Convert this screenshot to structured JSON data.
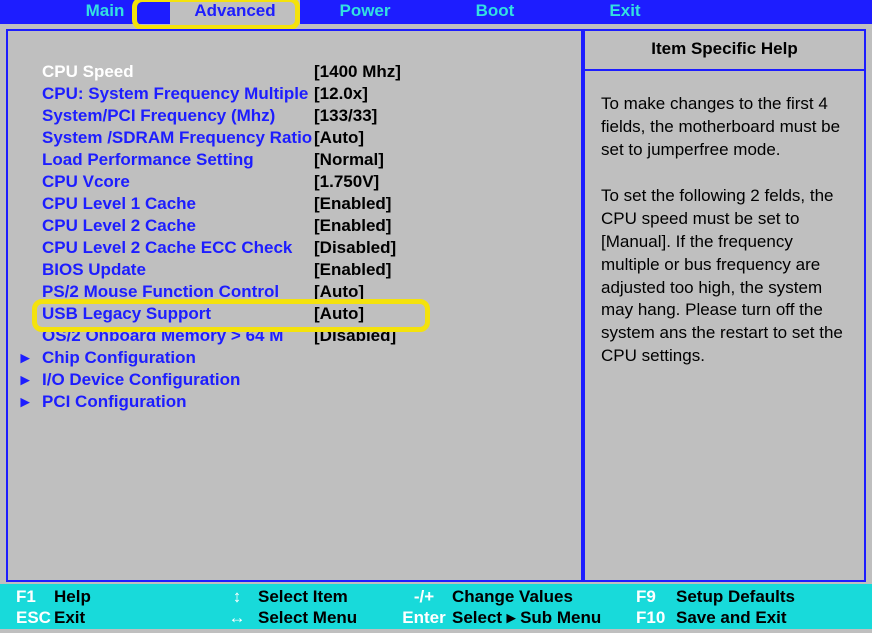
{
  "menu": {
    "items": [
      "Main",
      "Advanced",
      "Power",
      "Boot",
      "Exit"
    ],
    "active_index": 1
  },
  "settings": [
    {
      "label": "CPU Speed",
      "value": "[1400 Mhz]",
      "white": true
    },
    {
      "label": "CPU: System Frequency Multiple",
      "value": "[12.0x]"
    },
    {
      "label": "System/PCI Frequency (Mhz)",
      "value": "[133/33]"
    },
    {
      "label": "System /SDRAM Frequency Ratio",
      "value": "[Auto]"
    },
    {
      "label": "Load Performance Setting",
      "value": "[Normal]"
    },
    {
      "label": "CPU Vcore",
      "value": "[1.750V]"
    },
    {
      "label": "CPU Level 1 Cache",
      "value": "[Enabled]"
    },
    {
      "label": "CPU Level 2 Cache",
      "value": "[Enabled]"
    },
    {
      "label": "CPU Level 2 Cache ECC Check",
      "value": "[Disabled]"
    },
    {
      "label": "BIOS Update",
      "value": "[Enabled]"
    },
    {
      "label": "PS/2 Mouse Function Control",
      "value": "[Auto]"
    },
    {
      "label": "USB Legacy Support",
      "value": "[Auto]",
      "highlighted": true
    },
    {
      "label": "OS/2 Onboard Memory > 64 M",
      "value": "[Disabled]"
    }
  ],
  "submenus": [
    "Chip Configuration",
    "I/O Device Configuration",
    "PCI Configuration"
  ],
  "help": {
    "title": "Item Specific Help",
    "body": "To make changes to the first 4 fields, the motherboard must be set to jumperfree mode.\n\nTo set the following 2 felds, the CPU speed must be set to [Manual]. If the frequency multiple or bus frequency are adjusted too high, the system may hang. Please turn off the system ans the restart to set the CPU settings."
  },
  "footer": {
    "f1": "F1",
    "f1_label": "Help",
    "updown": "↕",
    "updown_label": "Select Item",
    "pm": "-/+",
    "pm_label": "Change Values",
    "f9": "F9",
    "f9_label": "Setup Defaults",
    "esc": "ESC",
    "esc_label": "Exit",
    "lr": "↔",
    "lr_label": "Select Menu",
    "enter": "Enter",
    "enter_label": "Select ▸ Sub Menu",
    "f10": "F10",
    "f10_label": "Save and Exit"
  }
}
